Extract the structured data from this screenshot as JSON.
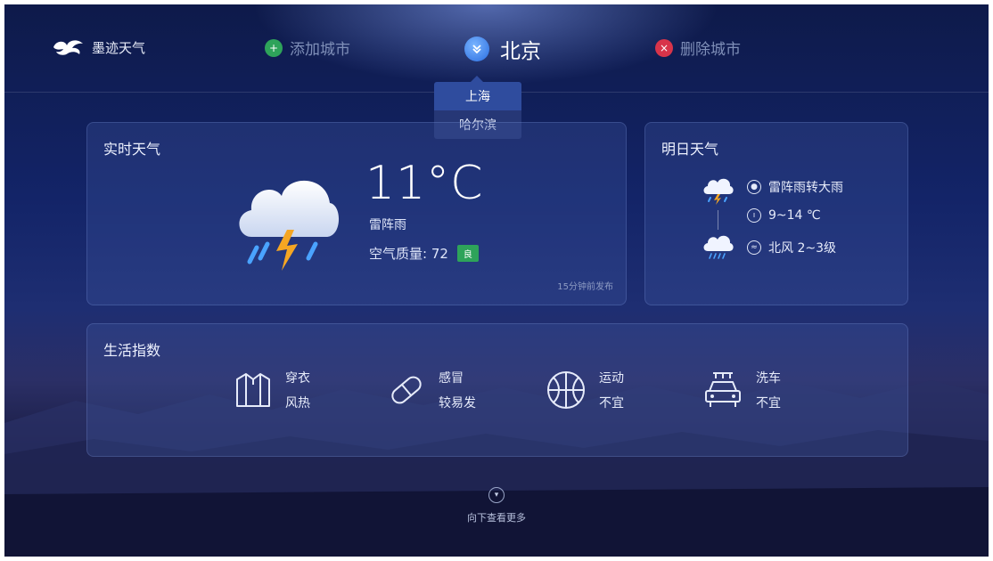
{
  "header": {
    "app_name": "墨迹天气",
    "add_city": "添加城市",
    "current_city": "北京",
    "delete_city": "删除城市"
  },
  "city_dropdown": {
    "options": [
      "上海",
      "哈尔滨"
    ],
    "selected": "上海"
  },
  "now_weather": {
    "title": "实时天气",
    "temperature": "11°C",
    "condition": "雷阵雨",
    "aqi_label": "空气质量: 72",
    "aqi_badge": "良",
    "update_text": "15分钟前发布"
  },
  "tomorrow_weather": {
    "title": "明日天气",
    "condition": "雷阵雨转大雨",
    "temperature": "9~14 ℃",
    "wind": "北风 2~3级"
  },
  "life_index": {
    "title": "生活指数",
    "items": [
      {
        "label": "穿衣",
        "value": "风热",
        "icon": "shirt-icon"
      },
      {
        "label": "感冒",
        "value": "较易发",
        "icon": "pill-icon"
      },
      {
        "label": "运动",
        "value": "不宜",
        "icon": "basketball-icon"
      },
      {
        "label": "洗车",
        "value": "不宜",
        "icon": "car-wash-icon"
      }
    ]
  },
  "footer": {
    "more_text": "向下查看更多"
  },
  "colors": {
    "accent_green": "#2ea35a",
    "accent_red": "#d8344a",
    "accent_blue": "#2f4c9e"
  }
}
